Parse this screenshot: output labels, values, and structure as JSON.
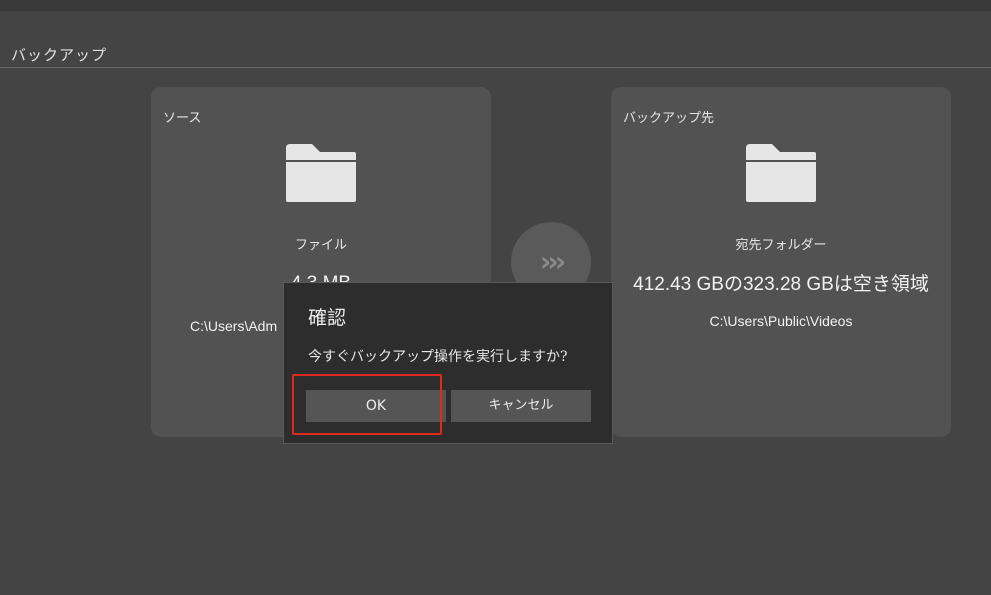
{
  "page": {
    "section_title": "バックアップ"
  },
  "source_card": {
    "title": "ソース",
    "icon": "folder-icon",
    "subtitle": "ファイル",
    "size": "4.3 MB",
    "path": "C:\\Users\\Adm"
  },
  "destination_card": {
    "title": "バックアップ先",
    "icon": "folder-icon",
    "subtitle": "宛先フォルダー",
    "space": "412.43 GBの323.28 GBは空き領域",
    "path": "C:\\Users\\Public\\Videos"
  },
  "arrows": {
    "glyph": "›››"
  },
  "dialog": {
    "title": "確認",
    "message": "今すぐバックアップ操作を実行しますか?",
    "ok_label": "OK",
    "cancel_label": "キャンセル"
  },
  "colors": {
    "background": "#444444",
    "card": "#525252",
    "dialog": "#2d2d2d",
    "button": "#555555",
    "highlight": "#e0281e"
  }
}
